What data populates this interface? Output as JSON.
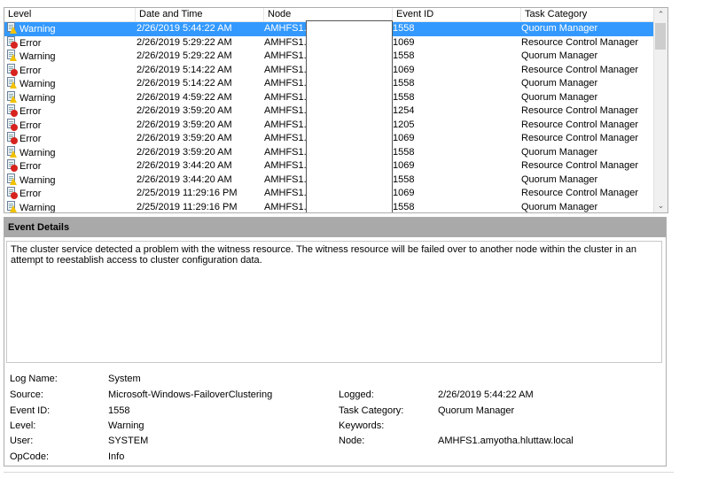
{
  "columns": {
    "level": "Level",
    "date": "Date and Time",
    "node": "Node",
    "event_id": "Event ID",
    "task": "Task Category"
  },
  "rows": [
    {
      "level": "Warning",
      "date": "2/26/2019 5:44:22 AM",
      "node": "AMHFS1.",
      "id": "1558",
      "task": "Quorum Manager",
      "type": "warning",
      "selected": true
    },
    {
      "level": "Error",
      "date": "2/26/2019 5:29:22 AM",
      "node": "AMHFS1.",
      "id": "1069",
      "task": "Resource Control Manager",
      "type": "error"
    },
    {
      "level": "Warning",
      "date": "2/26/2019 5:29:22 AM",
      "node": "AMHFS1.",
      "id": "1558",
      "task": "Quorum Manager",
      "type": "warning"
    },
    {
      "level": "Error",
      "date": "2/26/2019 5:14:22 AM",
      "node": "AMHFS1.",
      "id": "1069",
      "task": "Resource Control Manager",
      "type": "error"
    },
    {
      "level": "Warning",
      "date": "2/26/2019 5:14:22 AM",
      "node": "AMHFS1.",
      "id": "1558",
      "task": "Quorum Manager",
      "type": "warning"
    },
    {
      "level": "Warning",
      "date": "2/26/2019 4:59:22 AM",
      "node": "AMHFS1.",
      "id": "1558",
      "task": "Quorum Manager",
      "type": "warning"
    },
    {
      "level": "Error",
      "date": "2/26/2019 3:59:20 AM",
      "node": "AMHFS1.",
      "id": "1254",
      "task": "Resource Control Manager",
      "type": "error"
    },
    {
      "level": "Error",
      "date": "2/26/2019 3:59:20 AM",
      "node": "AMHFS1.",
      "id": "1205",
      "task": "Resource Control Manager",
      "type": "error"
    },
    {
      "level": "Error",
      "date": "2/26/2019 3:59:20 AM",
      "node": "AMHFS1.",
      "id": "1069",
      "task": "Resource Control Manager",
      "type": "error"
    },
    {
      "level": "Warning",
      "date": "2/26/2019 3:59:20 AM",
      "node": "AMHFS1.",
      "id": "1558",
      "task": "Quorum Manager",
      "type": "warning"
    },
    {
      "level": "Error",
      "date": "2/26/2019 3:44:20 AM",
      "node": "AMHFS1.",
      "id": "1069",
      "task": "Resource Control Manager",
      "type": "error"
    },
    {
      "level": "Warning",
      "date": "2/26/2019 3:44:20 AM",
      "node": "AMHFS1.",
      "id": "1558",
      "task": "Quorum Manager",
      "type": "warning"
    },
    {
      "level": "Error",
      "date": "2/25/2019 11:29:16 PM",
      "node": "AMHFS1.",
      "id": "1069",
      "task": "Resource Control Manager",
      "type": "error"
    },
    {
      "level": "Warning",
      "date": "2/25/2019 11:29:16 PM",
      "node": "AMHFS1.",
      "id": "1558",
      "task": "Quorum Manager",
      "type": "warning"
    }
  ],
  "icons": {
    "warning": "warning-event-icon",
    "error": "error-event-icon",
    "scroll_up": "chevron-up-icon",
    "scroll_down": "chevron-down-icon"
  },
  "details": {
    "title": "Event Details",
    "description": "The cluster service detected a problem with the witness resource. The witness resource will be failed over to another node within the cluster in an attempt to reestablish access to cluster configuration data.",
    "log_name_label": "Log Name:",
    "log_name": "System",
    "source_label": "Source:",
    "source": "Microsoft-Windows-FailoverClustering",
    "event_id_label": "Event ID:",
    "event_id": "1558",
    "level_label": "Level:",
    "level": "Warning",
    "user_label": "User:",
    "user": "SYSTEM",
    "opcode_label": "OpCode:",
    "opcode": "Info",
    "logged_label": "Logged:",
    "logged": "2/26/2019 5:44:22 AM",
    "task_label": "Task Category:",
    "task": "Quorum Manager",
    "keywords_label": "Keywords:",
    "keywords": "",
    "node_label": "Node:",
    "node": "AMHFS1.amyotha.hluttaw.local"
  },
  "colors": {
    "selection": "#3399ff",
    "warning": "#f2c200",
    "error": "#d7231e",
    "details_header": "#a9a9a9"
  }
}
